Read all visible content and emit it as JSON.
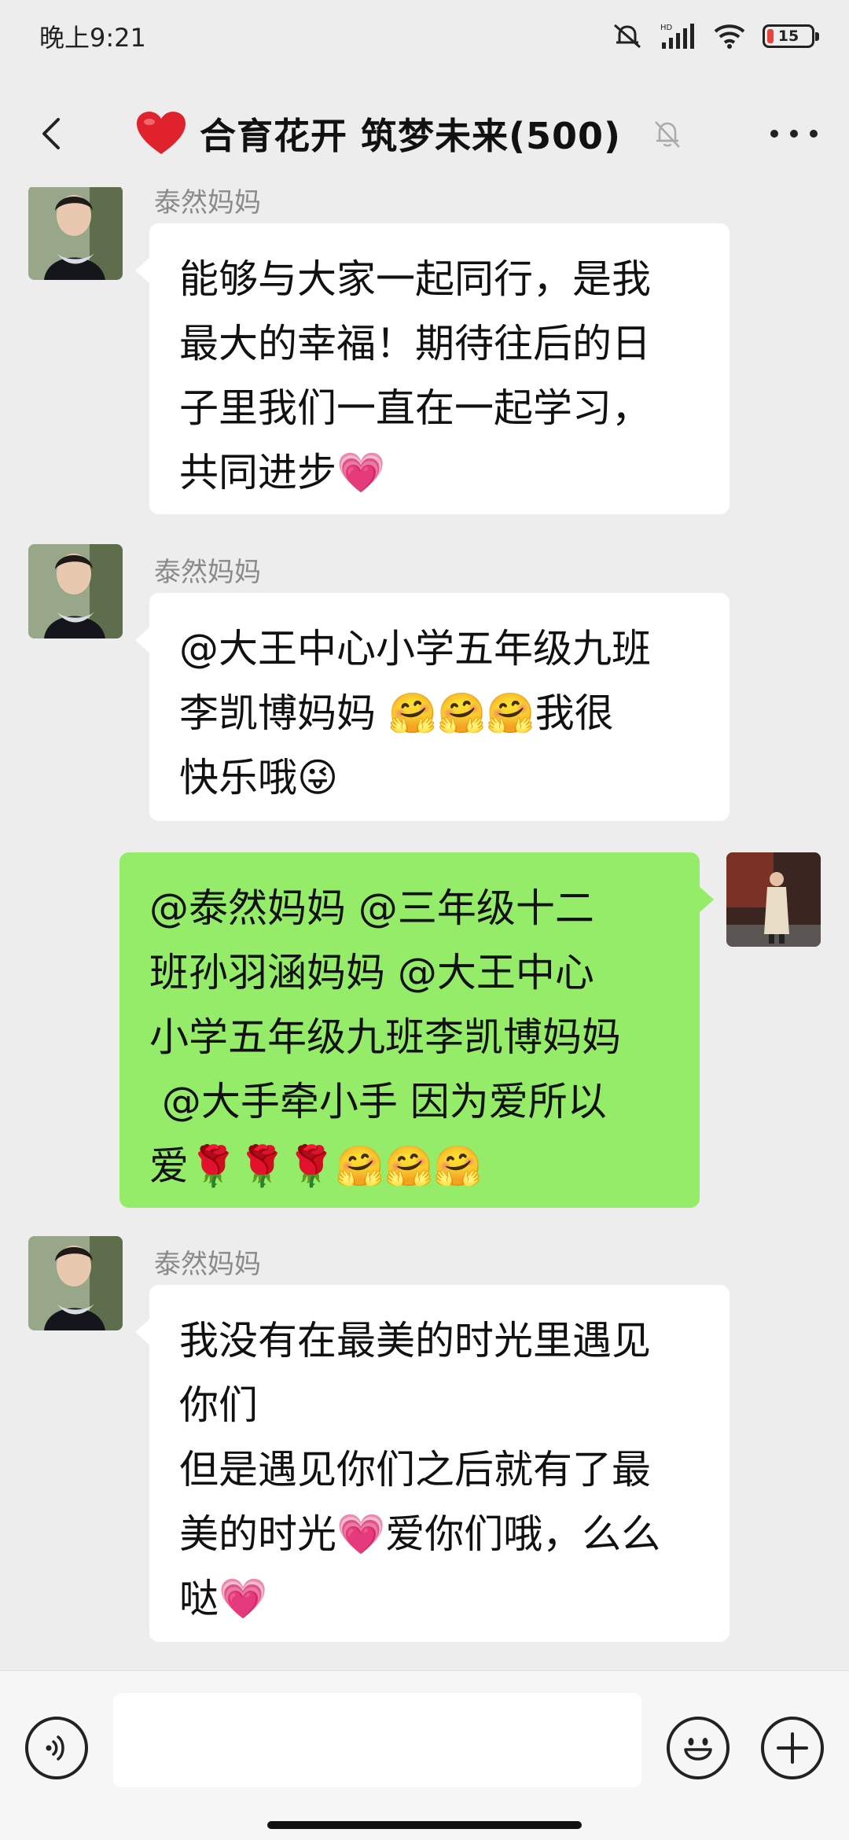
{
  "status_bar": {
    "time": "晚上9:21",
    "network": "HD",
    "battery_level": "15",
    "battery_color": "#e8433c"
  },
  "header": {
    "back_icon": "chevron-left-icon",
    "group_icon": "red-heart-emoji",
    "title": "合育花开 筑梦未来(500)",
    "muted_icon": "bell-off-icon",
    "more_icon": "more-dots-icon"
  },
  "messages": [
    {
      "side": "left",
      "sender": "泰然妈妈",
      "text": "能够与大家一起同行，是我\n最大的幸福！期待往后的日\n子里我们一直在一起学习，\n共同进步💗"
    },
    {
      "side": "left",
      "sender": "泰然妈妈",
      "text": "@大王中心小学五年级九班\n李凯博妈妈 🤗🤗🤗我很\n快乐哦😜"
    },
    {
      "side": "right",
      "sender": "",
      "text": "@泰然妈妈 @三年级十二\n班孙羽涵妈妈 @大王中心\n小学五年级九班李凯博妈妈\n @大手牵小手 因为爱所以\n爱🌹🌹🌹🤗🤗🤗"
    },
    {
      "side": "left",
      "sender": "泰然妈妈",
      "text": "我没有在最美的时光里遇见\n你们\n但是遇见你们之后就有了最\n美的时光💗爱你们哦，么么\n哒💗"
    }
  ],
  "input_bar": {
    "voice_icon": "voice-icon",
    "placeholder": "",
    "emoji_icon": "emoji-icon",
    "plus_icon": "plus-icon"
  },
  "colors": {
    "background": "#ededed",
    "bubble_left": "#ffffff",
    "bubble_right": "#95ec69",
    "sender_name": "#8a8a8a"
  }
}
